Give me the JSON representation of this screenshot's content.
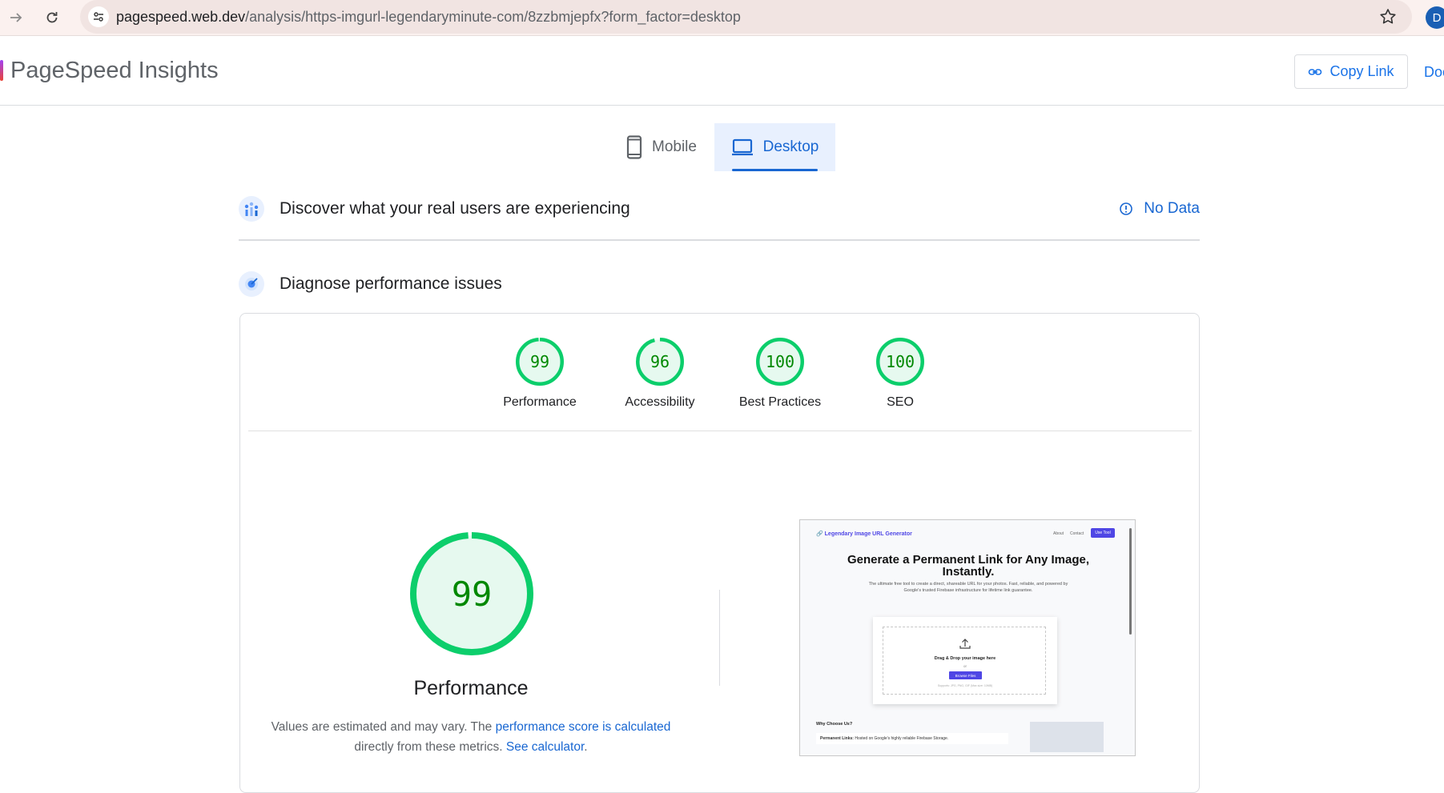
{
  "browser": {
    "url_host": "pagespeed.web.dev",
    "url_path": "/analysis/https-imgurl-legendaryminute-com/8zzbmjepfx?form_factor=desktop",
    "profile_initial": "D"
  },
  "header": {
    "title": "PageSpeed Insights",
    "copy_link_label": "Copy Link",
    "docs_label": "Doc"
  },
  "tabs": [
    {
      "label": "Mobile",
      "selected": false
    },
    {
      "label": "Desktop",
      "selected": true
    }
  ],
  "field_data": {
    "title": "Discover what your real users are experiencing",
    "status": "No Data"
  },
  "diagnose": {
    "title": "Diagnose performance issues"
  },
  "categories": [
    {
      "label": "Performance",
      "score": "99",
      "fraction": 0.99
    },
    {
      "label": "Accessibility",
      "score": "96",
      "fraction": 0.96
    },
    {
      "label": "Best Practices",
      "score": "100",
      "fraction": 1.0
    },
    {
      "label": "SEO",
      "score": "100",
      "fraction": 1.0
    }
  ],
  "performance": {
    "score": "99",
    "fraction": 0.99,
    "label": "Performance",
    "note_prefix": "Values are estimated and may vary. The ",
    "note_link": "performance score is calculated",
    "note_middle": " directly from these metrics. ",
    "note_calc_link": "See calculator",
    "note_suffix": "."
  },
  "screenshot": {
    "brand": "🔗 Legendary Image URL Generator",
    "nav_about": "About",
    "nav_contact": "Contact",
    "nav_cta": "Use Tool",
    "headline": "Generate a Permanent Link for Any Image, Instantly.",
    "subtext": "The ultimate free tool to create a direct, shareable URL for your photos. Fast, reliable, and powered by Google's trusted Firebase infrastructure for lifetime link guarantee.",
    "drag_text": "Drag & Drop your image here",
    "or_text": "or",
    "browse_label": "Browse Files",
    "supports_text": "Supports: JPG, PNG, GIF (Max size: 10MB)",
    "why_title": "Why Choose Us?",
    "feature_1_bold": "Permanent Links:",
    "feature_1_text": " Hosted on Google's highly reliable Firebase Storage."
  },
  "colors": {
    "pass_green": "#0cce6b",
    "pass_text": "#008800",
    "pass_fill": "#e6f9ef",
    "link_blue": "#1967d2"
  }
}
